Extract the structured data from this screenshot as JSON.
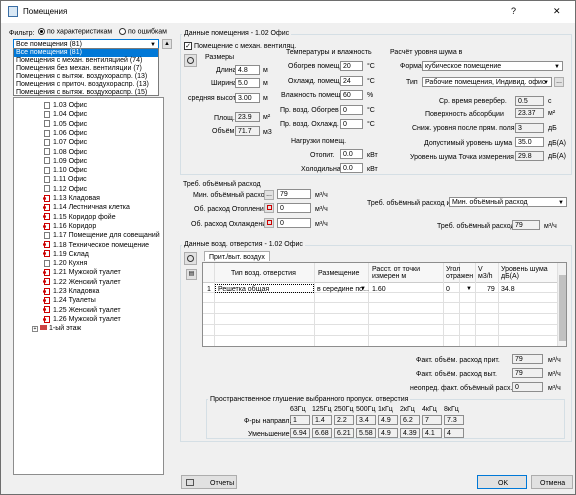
{
  "window": {
    "title": "Помещения",
    "help": "?",
    "close": "✕"
  },
  "filter": {
    "label": "Фильтр:",
    "radio1": "по характеристикам",
    "radio2": "по ошибкам",
    "selected": "Все помещения (81)",
    "options": [
      "Все помещения (81)",
      "Помещения с механ. вентиляцией (74)",
      "Помещения без механ. вентиляции (7)",
      "Помещения с вытяж. воздухораспр. (13)",
      "Помещения с приточ. воздухораспр. (13)",
      "Помещения с вытяж. воздухораспр. (15)"
    ]
  },
  "tree": {
    "items": [
      {
        "label": "1.03 Офис",
        "warn": false
      },
      {
        "label": "1.04 Офис",
        "warn": false
      },
      {
        "label": "1.05 Офис",
        "warn": false
      },
      {
        "label": "1.06 Офис",
        "warn": false
      },
      {
        "label": "1.07 Офис",
        "warn": false
      },
      {
        "label": "1.08 Офис",
        "warn": false
      },
      {
        "label": "1.09 Офис",
        "warn": false
      },
      {
        "label": "1.10 Офис",
        "warn": false
      },
      {
        "label": "1.11 Офис",
        "warn": false
      },
      {
        "label": "1.12 Офис",
        "warn": false
      },
      {
        "label": "1.13 Кладовая",
        "warn": true
      },
      {
        "label": "1.14 Лестничная клетка",
        "warn": true
      },
      {
        "label": "1.15 Коридор фойе",
        "warn": true
      },
      {
        "label": "1.16 Коридор",
        "warn": true
      },
      {
        "label": "1.17 Помещение для совещаний",
        "warn": false
      },
      {
        "label": "1.18 Техническое помещение",
        "warn": true
      },
      {
        "label": "1.19 Склад",
        "warn": true
      },
      {
        "label": "1.20 Кухня",
        "warn": false
      },
      {
        "label": "1.21 Мужской туалет",
        "warn": true
      },
      {
        "label": "1.22 Женский туалет",
        "warn": true
      },
      {
        "label": "1.23 Кладовка",
        "warn": true
      },
      {
        "label": "1.24 Туалеты",
        "warn": true
      },
      {
        "label": "1.25 Женский туалет",
        "warn": true
      },
      {
        "label": "1.26 Мужской туалет",
        "warn": true
      }
    ],
    "floor": "1-ый этаж"
  },
  "room": {
    "title": "Данные помещения - 1.02 Офис",
    "mech_vent_label": "Помещение с механ. вентиляц.",
    "sizes": {
      "heading": "Размеры",
      "length_label": "Длина",
      "length": "4.8",
      "length_unit": "м",
      "width_label": "Ширина",
      "width": "5.0",
      "width_unit": "м",
      "height_label": "средняя высота",
      "height": "3.00",
      "height_unit": "м",
      "area_label": "Площ.",
      "area": "23.9",
      "area_unit": "м²",
      "volume_label": "Объём",
      "volume": "71.7",
      "volume_unit": "м3"
    },
    "temps": {
      "heading": "Температуры и влажность",
      "heat_label": "Обогрев помещ.",
      "heat": "20",
      "heat_unit": "°C",
      "cool_label": "Охлажд. помещ.",
      "cool": "24",
      "cool_unit": "°C",
      "hum_label": "Влажность помещ.",
      "hum": "60",
      "hum_unit": "%",
      "airheat_label": "Пр. возд. Обогрев",
      "airheat": "0",
      "airheat_unit": "°C",
      "aircool_label": "Пр. возд. Охлажд.",
      "aircool": "0",
      "aircool_unit": "°C"
    },
    "loads": {
      "heading": "Нагрузки помещ.",
      "heat_label": "Отопит.",
      "heat": "0.0",
      "heat_unit": "кВт",
      "cool_label": "Холодильная",
      "cool": "0.0",
      "cool_unit": "кВт"
    },
    "noise": {
      "heading": "Расчёт уровня шума в",
      "form_label": "Форма",
      "form": "кубическое помещение",
      "type_label": "Тип",
      "type": "Рабочие помещения, Индивид. офис",
      "type_btn": "...",
      "reverb_label": "Ср. время ревербер.",
      "reverb": "0.5",
      "reverb_unit": "с",
      "absorb_label": "Поверхность абсорбции",
      "absorb": "23.37",
      "absorb_unit": "м²",
      "reduce_label": "Сниж. уровня после прям. поля",
      "reduce": "3",
      "reduce_unit": "дБ",
      "allowed_label": "Допустимый уровень шума",
      "allowed": "35.0",
      "allowed_unit": "дБ(А)",
      "point_label": "Уровень шума Точка измерения",
      "point": "29.8",
      "point_unit": "дБ(А)"
    }
  },
  "flow": {
    "heading": "Треб. объёмный расход",
    "min_label": "Мин. объёмный расход",
    "min_btn": "...",
    "min": "79",
    "min_unit": "м³/ч",
    "heat_label": "Об. расход Отопление",
    "heat": "0",
    "heat_unit": "м³/ч",
    "cool_label": "Об. расход Охлаждение",
    "cool": "0",
    "cool_unit": "м³/ч",
    "from_label": "Треб. объёмный расход из:",
    "from": "Мин. объёмный расход",
    "req_label": "Треб. объёмный расход",
    "req": "79",
    "req_unit": "м³/ч"
  },
  "openings": {
    "heading": "Данные возд. отверстия - 1.02 Офис",
    "tab": "Прит./выт. воздух",
    "columns": [
      "Тип возд. отверстия",
      "Размещение",
      "Расст. от точки измерен м",
      "Угол отражен",
      "V м3/h",
      "Уровень шума дБ(А)"
    ],
    "row": {
      "num": "1",
      "type": "Решетка общая",
      "place": "в середине по...",
      "dist": "1.60",
      "angle": "0",
      "v": "79",
      "noise": "34.8"
    },
    "supply_label": "Факт. объём. расход прит.",
    "supply": "79",
    "supply_unit": "м³/ч",
    "exhaust_label": "Факт. объём. расход выт.",
    "exhaust": "79",
    "exhaust_unit": "м³/ч",
    "undef_label": "неопред. факт. объёмный расх.",
    "undef": "0",
    "undef_unit": "м³/ч"
  },
  "attenuation": {
    "heading": "Пространственное глушение выбранного пропуск. отверстия",
    "bands": [
      "63Гц",
      "125Гц",
      "250Гц",
      "500Гц",
      "1кГц",
      "2кГц",
      "4кГц",
      "8кГц"
    ],
    "row1_label": "Ф-ры направл.",
    "row1": [
      "1",
      "1.4",
      "2.2",
      "3.4",
      "4.9",
      "6.2",
      "7",
      "7.3"
    ],
    "row2_label": "Уменьшение",
    "row2": [
      "6.94",
      "6.68",
      "6.21",
      "5.58",
      "4.9",
      "4.39",
      "4.1",
      "4"
    ]
  },
  "footer": {
    "reports": "Отчеты",
    "ok": "OK",
    "cancel": "Отмена"
  }
}
